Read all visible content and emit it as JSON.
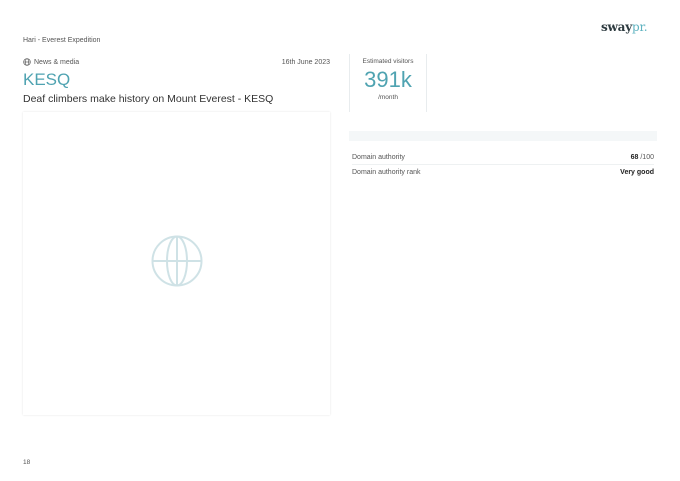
{
  "brand": {
    "name": "sway",
    "accent": "pr."
  },
  "breadcrumb": "Hari - Everest Expedition",
  "article": {
    "category": "News & media",
    "date": "16th June 2023",
    "outlet": "KESQ",
    "headline": "Deaf climbers make history on Mount Everest - KESQ"
  },
  "visitors": {
    "label": "Estimated visitors",
    "value": "391k",
    "unit": "/month"
  },
  "stats": {
    "domain_authority": {
      "label": "Domain authority",
      "value": "68",
      "suffix": " /100"
    },
    "domain_authority_rank": {
      "label": "Domain authority rank",
      "value": "Very good"
    }
  },
  "page_number": "18",
  "colors": {
    "accent": "#4fa3b1",
    "placeholder_icon": "#cfe2e6"
  },
  "icons": {
    "category": "globe-icon",
    "image_placeholder": "globe-icon"
  }
}
